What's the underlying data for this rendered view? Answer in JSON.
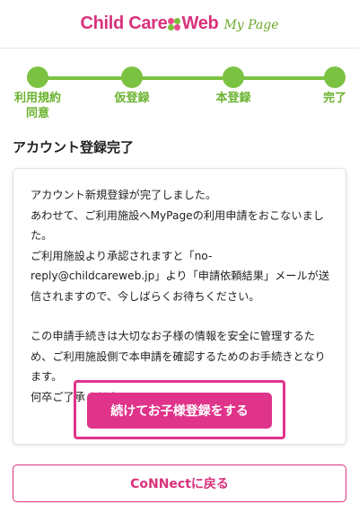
{
  "header": {
    "logo_main_left": "Child Care",
    "logo_main_right": "Web",
    "logo_sub": "My Page",
    "brand_pink": "#d9327c",
    "brand_green": "#7cc242"
  },
  "steps": [
    {
      "label_line1": "利用規約",
      "label_line2": "同意"
    },
    {
      "label_line1": "仮登録",
      "label_line2": ""
    },
    {
      "label_line1": "本登録",
      "label_line2": ""
    },
    {
      "label_line1": "完了",
      "label_line2": ""
    }
  ],
  "page_title": "アカウント登録完了",
  "message": {
    "line1": "アカウント新規登録が完了しました。",
    "line2": "あわせて、ご利用施設へMyPageの利用申請をおこないました。",
    "line3": "ご利用施設より承認されますと「no-reply@childcareweb.jp」より「申請依頼結果」メールが送信されますので、今しばらくお待ちください。",
    "line4": "この申請手続きは大切なお子様の情報を安全に管理するため、ご利用施設側で本申請を確認するためのお手続きとなります。",
    "line5": "何卒ご了承ください。"
  },
  "buttons": {
    "continue_label": "続けてお子様登録をする",
    "back_label": "CoNNectに戻る"
  }
}
